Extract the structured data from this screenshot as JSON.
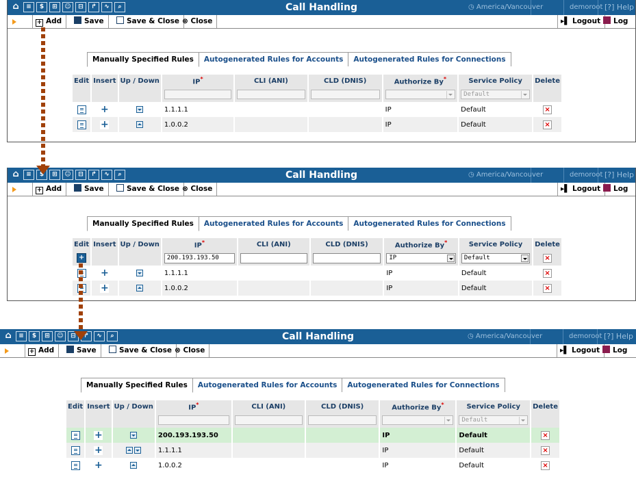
{
  "title": "Call Handling",
  "timezone": "America/Vancouver",
  "username": "demoroot",
  "help_label": "Help",
  "toolbar": {
    "add": "Add",
    "save": "Save",
    "save_close": "Save & Close",
    "close": "Close",
    "logout": "Logout",
    "log": "Log"
  },
  "tabs": [
    "Manually Specified Rules",
    "Autogenerated Rules for Accounts",
    "Autogenerated Rules for Connections"
  ],
  "columns": {
    "edit": "Edit",
    "insert": "Insert",
    "updown": "Up / Down",
    "ip": "IP",
    "cli": "CLI (ANI)",
    "cld": "CLD (DNIS)",
    "authorize_by": "Authorize By",
    "service_policy": "Service Policy",
    "delete": "Delete"
  },
  "filter": {
    "service_policy": "Default"
  },
  "panel1": {
    "rows": [
      {
        "ip": "1.1.1.1",
        "authorize_by": "IP",
        "service_policy": "Default"
      },
      {
        "ip": "1.0.0.2",
        "authorize_by": "IP",
        "service_policy": "Default"
      }
    ]
  },
  "panel2": {
    "new_row": {
      "ip": "200.193.193.50",
      "authorize_by": "IP",
      "service_policy": "Default"
    },
    "rows": [
      {
        "ip": "1.1.1.1",
        "authorize_by": "IP",
        "service_policy": "Default"
      },
      {
        "ip": "1.0.0.2",
        "authorize_by": "IP",
        "service_policy": "Default"
      }
    ]
  },
  "panel3": {
    "rows": [
      {
        "ip": "200.193.193.50",
        "authorize_by": "IP",
        "service_policy": "Default"
      },
      {
        "ip": "1.1.1.1",
        "authorize_by": "IP",
        "service_policy": "Default"
      },
      {
        "ip": "1.0.0.2",
        "authorize_by": "IP",
        "service_policy": "Default"
      }
    ]
  },
  "colors": {
    "titlebar": "#1a5f96",
    "highlight_row": "#d3efd3",
    "annotation": "#a0410a"
  }
}
